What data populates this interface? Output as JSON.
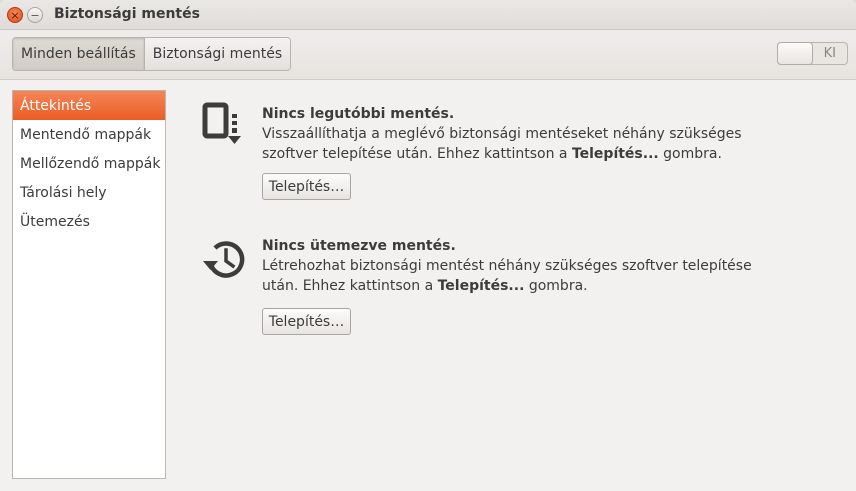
{
  "window": {
    "title": "Biztonsági mentés",
    "close_glyph": "×",
    "minimize_glyph": "−"
  },
  "toolbar": {
    "crumbs": [
      "Minden beállítás",
      "Biztonsági mentés"
    ],
    "toggle_label": "KI"
  },
  "sidebar": {
    "items": [
      {
        "label": "Áttekintés",
        "selected": true
      },
      {
        "label": "Mentendő mappák",
        "selected": false
      },
      {
        "label": "Mellőzendő mappák",
        "selected": false
      },
      {
        "label": "Tárolási hely",
        "selected": false
      },
      {
        "label": "Ütemezés",
        "selected": false
      }
    ]
  },
  "overview": {
    "backup": {
      "icon": "backup-restore-icon",
      "heading": "Nincs legutóbbi mentés.",
      "body_pre": "Visszaállíthatja a meglévő biztonsági mentéseket néhány szükséges szoftver telepítése után. Ehhez kattintson a ",
      "body_bold": "Telepítés...",
      "body_post": " gombra.",
      "button_label": "Telepítés…"
    },
    "schedule": {
      "icon": "history-clock-icon",
      "heading": "Nincs ütemezve mentés.",
      "body_pre": "Létrehozhat biztonsági mentést néhány szükséges szoftver telepítése után. Ehhez kattintson a ",
      "body_bold": "Telepítés...",
      "body_post": " gombra.",
      "button_label": "Telepítés…"
    }
  },
  "colors": {
    "accent": "#ea5e25",
    "window_bg": "#f2f1f0",
    "text": "#3c3c3c"
  }
}
